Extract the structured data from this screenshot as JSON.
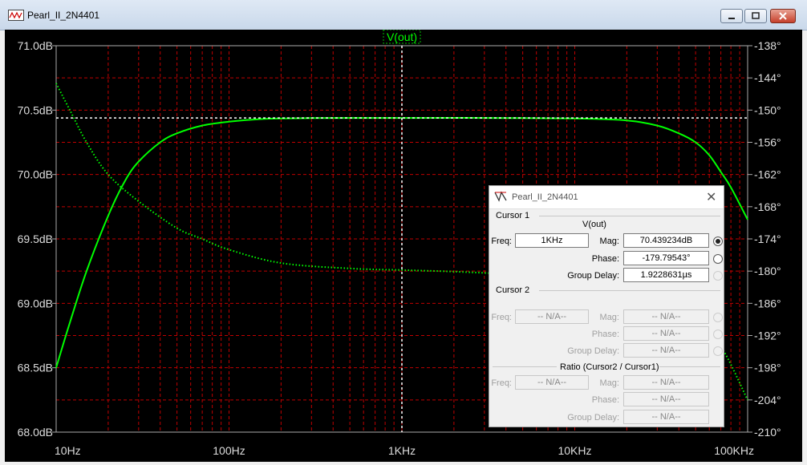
{
  "window": {
    "title": "Pearl_II_2N4401"
  },
  "plot": {
    "trace_name": "V(out)",
    "colors": {
      "background": "#000000",
      "grid": "#c00000",
      "magnitude_trace": "#00ff00",
      "phase_trace": "#00ff00",
      "cursor": "#ffffff"
    },
    "y_left_ticks": [
      "71.0dB",
      "70.5dB",
      "70.0dB",
      "69.5dB",
      "69.0dB",
      "68.5dB",
      "68.0dB"
    ],
    "y_right_ticks": [
      "-138°",
      "-144°",
      "-150°",
      "-156°",
      "-162°",
      "-168°",
      "-174°",
      "-180°",
      "-186°",
      "-192°",
      "-198°",
      "-204°",
      "-210°"
    ],
    "x_ticks": [
      "10Hz",
      "100Hz",
      "1KHz",
      "10KHz",
      "100KHz"
    ]
  },
  "chart_data": {
    "type": "line",
    "xscale": "log",
    "xlim": [
      10,
      100000
    ],
    "ylim_left": [
      68.0,
      71.0
    ],
    "ylim_right": [
      -210,
      -138
    ],
    "series": [
      {
        "axis": "left",
        "style": "solid",
        "x": [
          10,
          12,
          15,
          20,
          25,
          30,
          40,
          50,
          70,
          100,
          150,
          200,
          300,
          500,
          1000,
          3000,
          10000,
          20000,
          30000,
          40000,
          50000,
          60000,
          70000,
          80000,
          100000
        ],
        "values": [
          68.5,
          68.85,
          69.25,
          69.68,
          69.95,
          70.1,
          70.25,
          70.32,
          70.38,
          70.41,
          70.43,
          70.435,
          70.438,
          70.439,
          70.439,
          70.439,
          70.435,
          70.42,
          70.38,
          70.32,
          70.25,
          70.15,
          70.02,
          69.9,
          69.65
        ]
      },
      {
        "axis": "right",
        "style": "dotted",
        "x": [
          10,
          12,
          15,
          20,
          30,
          50,
          70,
          100,
          200,
          500,
          1000,
          2000,
          5000,
          10000,
          20000,
          50000,
          70000,
          100000
        ],
        "values": [
          -145,
          -150,
          -156,
          -162,
          -167,
          -172,
          -174,
          -176,
          -178.5,
          -179.5,
          -179.8,
          -180.1,
          -180.7,
          -181.6,
          -183.4,
          -189.5,
          -194,
          -204
        ]
      }
    ]
  },
  "cursor_dialog": {
    "title": "Pearl_II_2N4401",
    "cursor1": {
      "group_label": "Cursor 1",
      "trace": "V(out)",
      "freq_label": "Freq:",
      "freq_value": "1KHz",
      "mag_label": "Mag:",
      "mag_value": "70.439234dB",
      "phase_label": "Phase:",
      "phase_value": "-179.79543°",
      "group_delay_label": "Group Delay:",
      "group_delay_value": "1.9228631µs"
    },
    "cursor2": {
      "group_label": "Cursor 2",
      "freq_label": "Freq:",
      "freq_value": "-- N/A--",
      "mag_label": "Mag:",
      "mag_value": "-- N/A--",
      "phase_label": "Phase:",
      "phase_value": "-- N/A--",
      "group_delay_label": "Group Delay:",
      "group_delay_value": "-- N/A--"
    },
    "ratio": {
      "group_label": "Ratio (Cursor2 / Cursor1)",
      "freq_label": "Freq:",
      "freq_value": "-- N/A--",
      "mag_label": "Mag:",
      "mag_value": "-- N/A--",
      "phase_label": "Phase:",
      "phase_value": "-- N/A--",
      "group_delay_label": "Group Delay:",
      "group_delay_value": "-- N/A--"
    }
  }
}
